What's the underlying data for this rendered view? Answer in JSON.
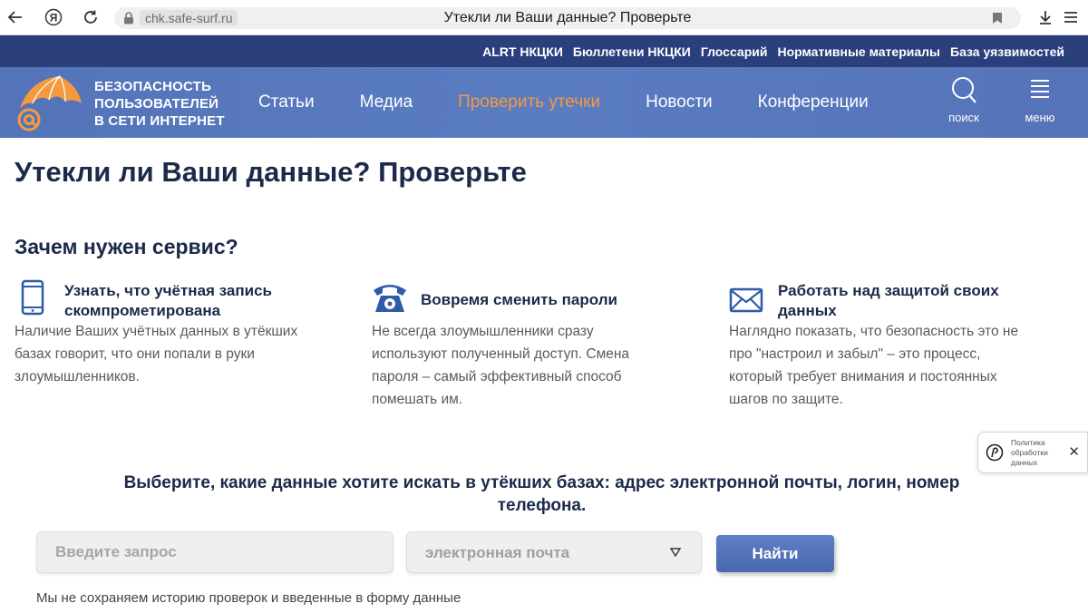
{
  "browser": {
    "domain": "chk.safe-surf.ru",
    "tab_title": "Утекли ли Ваши данные? Проверьте"
  },
  "top_links": [
    "ALRT НКЦКИ",
    "Бюллетени НКЦКИ",
    "Глоссарий",
    "Нормативные материалы",
    "База уязвимостей"
  ],
  "logo": {
    "line1": "БЕЗОПАСНОСТЬ",
    "line2": "ПОЛЬЗОВАТЕЛЕЙ",
    "line3": "В СЕТИ ИНТЕРНЕТ"
  },
  "nav": {
    "items": [
      {
        "label": "Статьи"
      },
      {
        "label": "Медиа"
      },
      {
        "label": "Проверить утечки"
      },
      {
        "label": "Новости"
      },
      {
        "label": "Конференции"
      }
    ],
    "search_label": "поиск",
    "menu_label": "меню"
  },
  "colors": {
    "top_strip": "#2b3f7c",
    "navbar": "#5778bd",
    "accent_orange": "#f39a40",
    "heading": "#1c2a4a",
    "icon_blue": "#2e5ba8"
  },
  "page_title": "Утекли ли Ваши данные? Проверьте",
  "section_title": "Зачем нужен сервис?",
  "features": [
    {
      "icon": "phone-icon",
      "head_line1": "Узнать, что учётная запись",
      "head_line2": "скомпрометирована",
      "body": [
        "Наличие Ваших учётных данных в утёкших",
        "базах говорит, что они попали в руки",
        "злоумышленников."
      ]
    },
    {
      "icon": "telephone-icon",
      "head_line1": "Вовремя сменить пароли",
      "head_line2": "",
      "body": [
        "Не всегда злоумышленники сразу",
        "используют полученный доступ. Смена",
        "пароля – самый эффективный способ",
        "помешать им."
      ]
    },
    {
      "icon": "envelope-icon",
      "head_line1": "Работать над защитой своих",
      "head_line2": "данных",
      "body": [
        "Наглядно показать, что безопасность это не",
        "про \"настроил и забыл\" – это процесс,",
        "который требует внимания и постоянных",
        "шагов по защите."
      ]
    }
  ],
  "prompt_line1": "Выберите, какие данные хотите искать в утёкших базах: адрес электронной почты, логин, номер",
  "prompt_line2": "телефона.",
  "search_form": {
    "placeholder": "Введите запрос",
    "value": "",
    "type_selected": "электронная почта",
    "button_label": "Найти"
  },
  "note": "Мы не сохраняем историю проверок и введенные в форму данные",
  "privacy_badge": {
    "line1": "Политика",
    "line2": "обработки",
    "line3": "данных"
  }
}
